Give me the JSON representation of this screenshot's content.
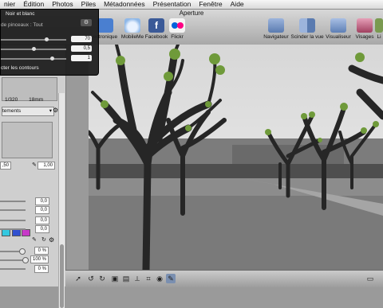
{
  "menubar": {
    "items": [
      "nier",
      "Édition",
      "Photos",
      "Piles",
      "Métadonnées",
      "Présentation",
      "Fenêtre",
      "Aide"
    ]
  },
  "window": {
    "title": "Aperture"
  },
  "toolbar": {
    "items": [
      {
        "label": "ectronique",
        "icon": "email-icon",
        "color": "#4a7fd0"
      },
      {
        "label": "MobileMe",
        "icon": "cloud-icon",
        "color": "#8fb8e8"
      },
      {
        "label": "Facebook",
        "icon": "facebook-icon",
        "color": "#3b5a98"
      },
      {
        "label": "Flickr",
        "icon": "flickr-icon",
        "color": "#f0f0f0"
      },
      {
        "label": "Navigateur",
        "icon": "browser-icon",
        "color": "#6a86b8"
      },
      {
        "label": "Scinder la vue",
        "icon": "split-view-icon",
        "color": "#5a7bb0"
      },
      {
        "label": "Visualiseur",
        "icon": "viewer-icon",
        "color": "#5e7fb5"
      },
      {
        "label": "Visages",
        "icon": "faces-icon",
        "color": "#c06080"
      },
      {
        "label": "Li",
        "icon": "places-icon",
        "color": "#7a9a50"
      }
    ]
  },
  "hud": {
    "title": "Noir et blanc",
    "brush_label": "de pinceaux : Tout",
    "sliders": [
      {
        "value": "70",
        "level": 0.7
      },
      {
        "value": "0,5",
        "level": 0.5
      },
      {
        "value": "1",
        "level": 0.8
      }
    ],
    "option_label": "cter les contours"
  },
  "inspector": {
    "info_line": "1/320",
    "info_focal": "18mm",
    "dropdown": "tements",
    "field_left": ",50",
    "field_right": "1,00",
    "values": [
      "0,0",
      "0,0",
      "0,0",
      "0,0"
    ],
    "bottom_values": [
      "0 %",
      "100 %",
      "0 %"
    ]
  },
  "colors": {
    "accent": "#4a7fd0",
    "hud_bg": "#1e1e1e",
    "canopy": "#6f9a3a"
  }
}
